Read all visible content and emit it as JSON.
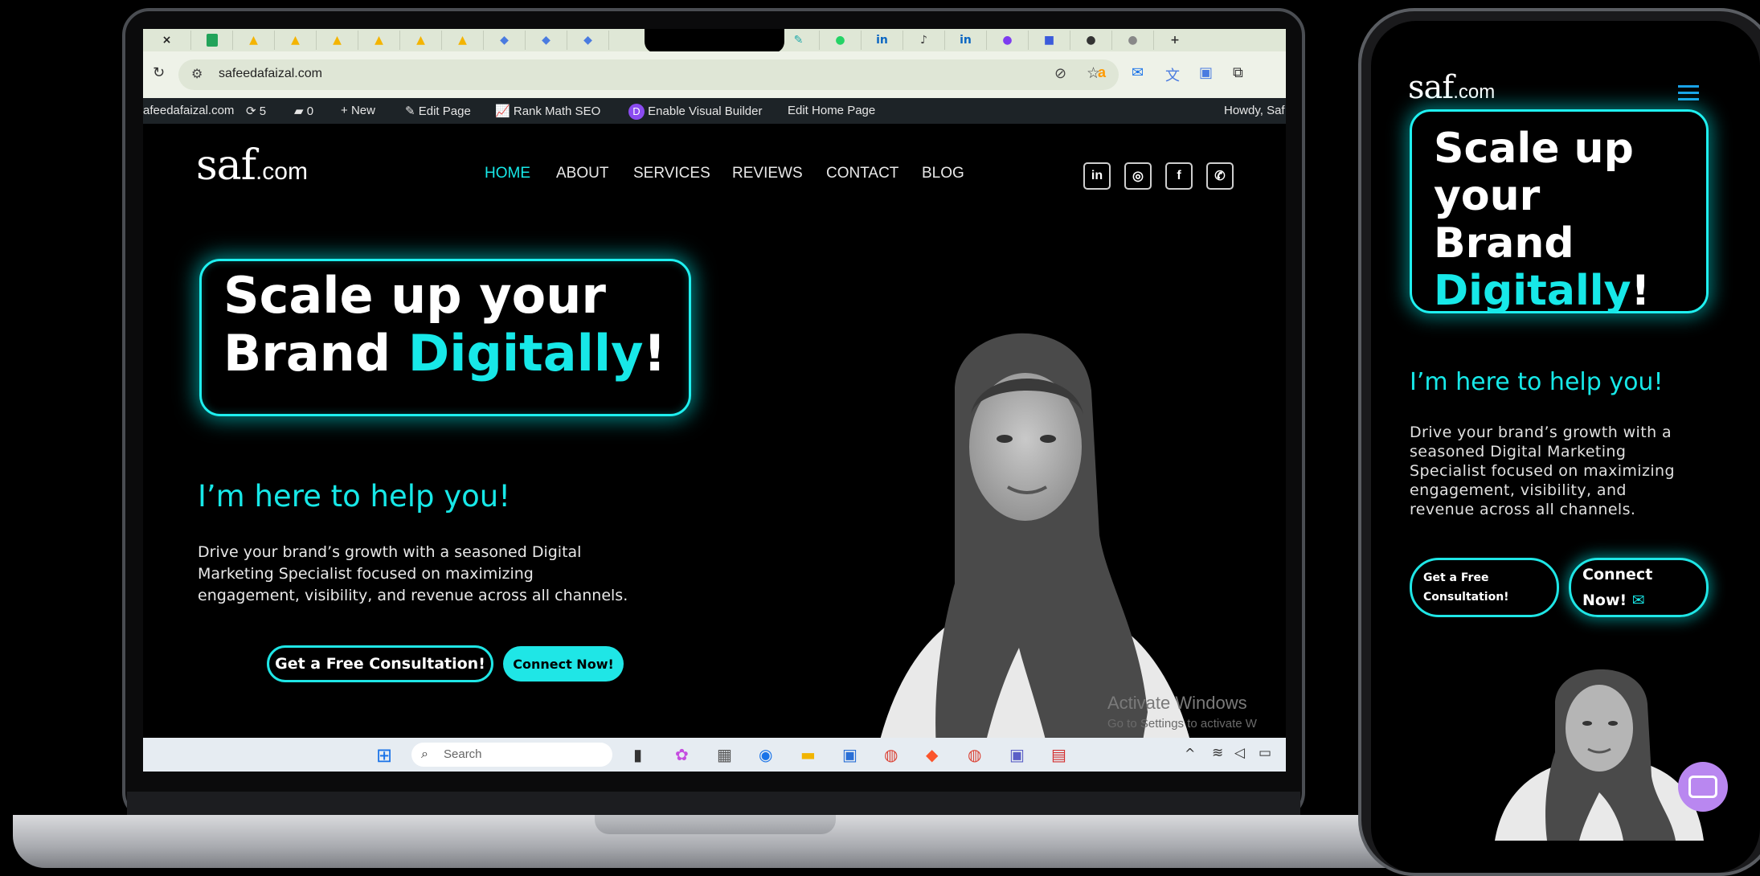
{
  "browser": {
    "tabs": [
      "×",
      "+"
    ],
    "url": "safeedafaizal.com"
  },
  "admin_bar": {
    "site": "afeedafaizal.com",
    "updates": "5",
    "comments": "0",
    "new": "New",
    "edit_page": "Edit Page",
    "rank_math": "Rank Math SEO",
    "visual_builder": "Enable Visual Builder",
    "edit_home": "Edit Home Page",
    "howdy": "Howdy, Saf"
  },
  "site": {
    "logo_main": "saf",
    "logo_suffix": ".com",
    "nav": [
      "HOME",
      "ABOUT",
      "SERVICES",
      "REVIEWS",
      "CONTACT",
      "BLOG"
    ],
    "social": [
      "in",
      "◎",
      "f",
      "✆"
    ],
    "hero_line1": "Scale up your",
    "hero_line2_a": "Brand ",
    "hero_line2_b": "Digitally",
    "hero_line2_c": "!",
    "subheading": "I’m here to help you!",
    "description_lines": [
      "Drive your brand’s growth with a seasoned Digital",
      "Marketing Specialist focused on maximizing",
      "engagement, visibility, and revenue across all channels."
    ],
    "cta_primary": "Get a Free Consultation!",
    "cta_secondary": "Connect Now!",
    "watermark_1": "Activate Windows",
    "watermark_2": "Go to Settings to activate W"
  },
  "taskbar": {
    "search": "Search"
  },
  "phone": {
    "hero_lines": [
      "Scale up",
      "your",
      "Brand"
    ],
    "hero_cyan": "Digitally",
    "hero_end": "!",
    "subheading": "I’m here to help you!",
    "description_lines": [
      "Drive your brand’s growth with a",
      "seasoned Digital Marketing",
      "Specialist focused on maximizing",
      "engagement, visibility, and",
      "revenue across all channels."
    ],
    "cta_primary_1": "Get a Free",
    "cta_primary_2": "Consultation!",
    "cta_secondary_1": "Connect",
    "cta_secondary_2": "Now!"
  },
  "colors": {
    "accent": "#17e8e8",
    "background": "#000000",
    "admin_bar": "#1d2327",
    "chat": "#b987f0"
  }
}
